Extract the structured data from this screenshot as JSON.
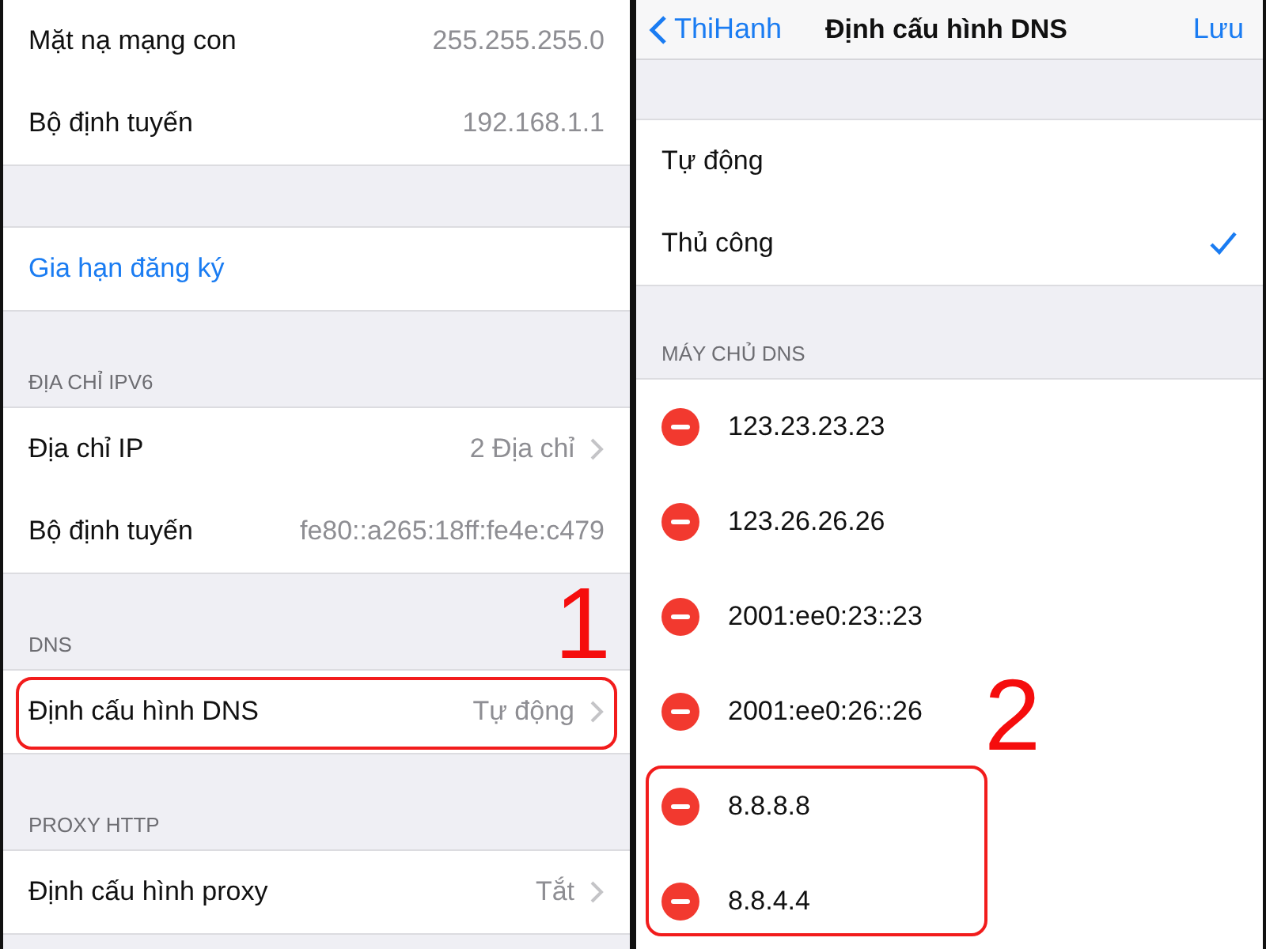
{
  "left": {
    "sections": [
      {
        "rows": [
          {
            "label": "Mặt nạ mạng con",
            "value": "255.255.255.0",
            "chevron": false,
            "kind": "info"
          },
          {
            "label": "Bộ định tuyến",
            "value": "192.168.1.1",
            "chevron": false,
            "kind": "info"
          }
        ]
      },
      {
        "rows": [
          {
            "label": "Gia hạn đăng ký",
            "chevron": false,
            "kind": "action"
          }
        ]
      },
      {
        "header": "ĐỊA CHỈ IPV6",
        "rows": [
          {
            "label": "Địa chỉ IP",
            "value": "2 Địa chỉ",
            "chevron": true,
            "kind": "info"
          },
          {
            "label": "Bộ định tuyến",
            "value": "fe80::a265:18ff:fe4e:c479",
            "chevron": false,
            "kind": "info"
          }
        ]
      },
      {
        "header": "DNS",
        "rows": [
          {
            "label": "Định cấu hình DNS",
            "value": "Tự động",
            "chevron": true,
            "kind": "info",
            "highlighted": true,
            "callout": "1"
          }
        ]
      },
      {
        "header": "PROXY HTTP",
        "rows": [
          {
            "label": "Định cấu hình proxy",
            "value": "Tắt",
            "chevron": true,
            "kind": "info"
          }
        ]
      }
    ]
  },
  "right": {
    "nav": {
      "back": "ThiHanh",
      "title": "Định cấu hình DNS",
      "action": "Lưu"
    },
    "modes": [
      {
        "label": "Tự động",
        "selected": false
      },
      {
        "label": "Thủ công",
        "selected": true
      }
    ],
    "servers_header": "MÁY CHỦ DNS",
    "servers": [
      {
        "address": "123.23.23.23",
        "highlighted": false
      },
      {
        "address": "123.26.26.26",
        "highlighted": false
      },
      {
        "address": "2001:ee0:23::23",
        "highlighted": false
      },
      {
        "address": "2001:ee0:26::26",
        "highlighted": false
      },
      {
        "address": "8.8.8.8",
        "highlighted": true
      },
      {
        "address": "8.8.4.4",
        "highlighted": true
      }
    ],
    "servers_callout": "2"
  }
}
